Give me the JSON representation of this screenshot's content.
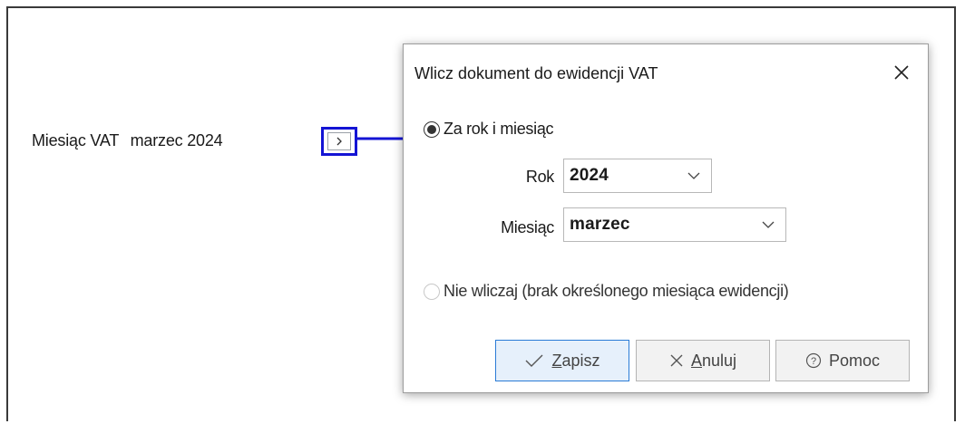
{
  "main": {
    "vat_label": "Miesiąc VAT",
    "vat_value": "marzec 2024",
    "expand_glyph": "›",
    "highlight_color": "#1414d4"
  },
  "dialog": {
    "title": "Wlicz dokument do ewidencji VAT",
    "close_glyph": "✕",
    "option_year_month": {
      "label": "Za rok i miesiąc",
      "checked": true
    },
    "year": {
      "label": "Rok",
      "value": "2024"
    },
    "month": {
      "label": "Miesiąc",
      "value": "marzec"
    },
    "option_none": {
      "label": "Nie wliczaj (brak określonego miesiąca ewidencji)",
      "checked": false
    },
    "buttons": {
      "save": {
        "mnemonic": "Z",
        "rest": "apisz",
        "icon": "check-icon"
      },
      "cancel": {
        "mnemonic": "A",
        "rest": "nuluj",
        "icon": "close-icon"
      },
      "help": {
        "label": "Pomoc",
        "icon": "help-icon"
      }
    }
  }
}
